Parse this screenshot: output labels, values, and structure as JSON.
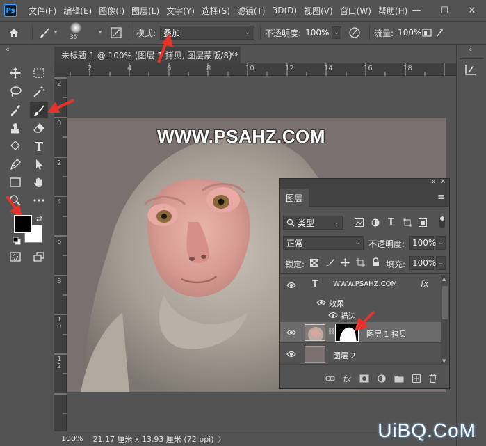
{
  "app": {
    "logo": "Ps"
  },
  "menu": [
    "文件(F)",
    "编辑(E)",
    "图像(I)",
    "图层(L)",
    "文字(Y)",
    "选择(S)",
    "滤镜(T)",
    "3D(D)",
    "视图(V)",
    "窗口(W)",
    "帮助(H)"
  ],
  "window_controls": {
    "minimize": "—",
    "maximize": "☐",
    "close": "✕"
  },
  "options": {
    "brush_size": "35",
    "mode_label": "模式:",
    "mode_value": "叠加",
    "opacity_label": "不透明度:",
    "opacity_value": "100%",
    "flow_label": "流量:",
    "flow_value": "100%"
  },
  "document": {
    "tab_title": "未标题-1 @ 100% (图层 1 拷贝, 图层蒙版/8) *",
    "tab_close": "×",
    "ruler_top": [
      "2",
      "2",
      "4",
      "6",
      "8",
      "10",
      "12",
      "14",
      "16",
      "18"
    ],
    "ruler_left": [
      "2",
      "0",
      "2",
      "4",
      "6",
      "8",
      "1\n0",
      "1\n2"
    ],
    "canvas_text": "WWW.PSAHZ.COM"
  },
  "colors": {
    "foreground": "#000000",
    "background": "#ffffff",
    "accent": "#31a8ff",
    "arrow": "#e8332a"
  },
  "layers_panel": {
    "tab": "图层",
    "filter_value": "类型",
    "blend_value": "正常",
    "opacity_label": "不透明度:",
    "opacity_value": "100%",
    "lock_label": "锁定:",
    "fill_label": "填充:",
    "fill_value": "100%",
    "layers": [
      {
        "name": "WWW.PSAHZ.COM",
        "kind": "text",
        "badge": "fx"
      },
      {
        "name": "效果",
        "kind": "effects"
      },
      {
        "name": "描边",
        "kind": "effect"
      },
      {
        "name": "图层 1 拷贝",
        "kind": "image-mask"
      },
      {
        "name": "图层 2",
        "kind": "fill"
      }
    ]
  },
  "status": {
    "zoom": "100%",
    "info": "21.17 厘米 x 13.93 厘米 (72 ppi)"
  },
  "watermark_logo": "UiBQ.CoM"
}
